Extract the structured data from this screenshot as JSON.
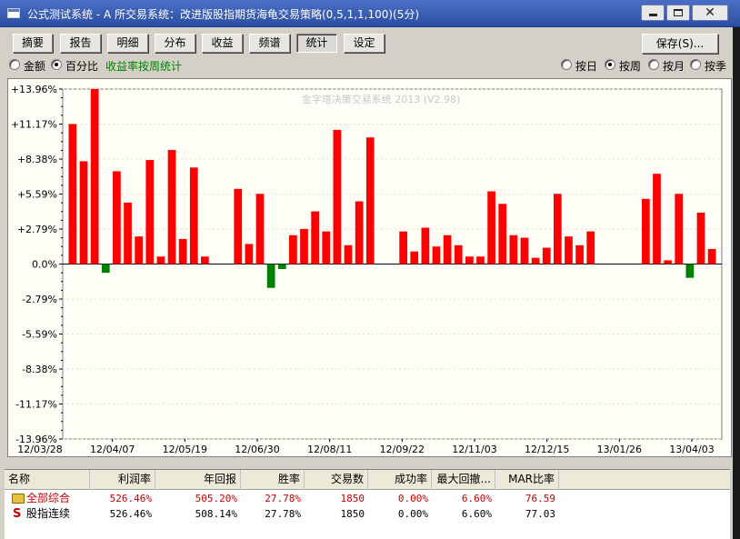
{
  "window": {
    "title": "公式测试系统 - A 所交易系统：改进版股指期货海龟交易策略(0,5,1,1,100)(5分)",
    "buttons": {
      "min": "minimize",
      "max": "maximize",
      "close": "close"
    }
  },
  "tabs": [
    "摘要",
    "报告",
    "明细",
    "分布",
    "收益",
    "频谱",
    "统计",
    "设定"
  ],
  "active_tab": "统计",
  "save_button": "保存(S)...",
  "mode_options": {
    "amount": "金额",
    "percent": "百分比",
    "selected": "百分比",
    "description": "收益率按周统计"
  },
  "period_options": {
    "day": "按日",
    "week": "按周",
    "month": "按月",
    "quarter": "按季",
    "selected": "按周"
  },
  "colors": {
    "positive": "#ff0000",
    "negative": "#008000",
    "background": "#fefdf6",
    "grid": "#d0d0d0"
  },
  "chart_data": {
    "type": "bar",
    "watermark": "金字塔决策交易系统 2013 (V2.98)",
    "ylim": [
      -13.96,
      13.96
    ],
    "ytick_labels": [
      "+13.96%",
      "+11.17%",
      "+8.38%",
      "+5.59%",
      "+2.79%",
      "0.0%",
      "-2.79%",
      "-5.59%",
      "-8.38%",
      "-11.17%",
      "-13.96%"
    ],
    "xtick_labels": [
      "12/03/28",
      "12/04/07",
      "12/05/19",
      "12/06/30",
      "12/08/11",
      "12/09/22",
      "12/11/03",
      "12/12/15",
      "13/01/26",
      "13/04/03"
    ],
    "series": [
      {
        "values": [
          11.17,
          8.2,
          13.96,
          -0.7,
          7.4,
          4.9,
          2.2,
          8.3,
          0.6,
          9.1,
          2.0,
          7.7,
          0.6,
          null,
          null,
          6.0,
          1.6,
          5.6,
          -1.9,
          -0.4,
          2.3,
          2.8,
          4.2,
          2.6,
          10.7,
          1.5,
          5.0,
          10.1,
          null,
          null,
          2.6,
          1.0,
          2.9,
          1.4,
          2.3,
          1.5,
          0.6,
          0.6,
          5.8,
          4.8,
          2.3,
          2.1,
          0.5,
          1.3,
          5.6,
          2.2,
          1.5,
          2.6,
          null,
          null,
          null,
          null,
          5.2,
          7.2,
          0.3,
          5.6,
          -1.1,
          4.1,
          1.2
        ]
      }
    ]
  },
  "table": {
    "headers": [
      "名称",
      "利润率",
      "年回报",
      "胜率",
      "交易数",
      "成功率",
      "最大回撤...",
      "MAR比率"
    ],
    "rows": [
      {
        "icon": "folder-icon",
        "name": "全部综合",
        "profit": "526.46%",
        "annual": "505.20%",
        "win": "27.78%",
        "trades": "1850",
        "success": "0.00%",
        "drawdown": "6.60%",
        "mar": "76.59"
      },
      {
        "icon": "stock-index-icon",
        "name": "股指连续",
        "profit": "526.46%",
        "annual": "508.14%",
        "win": "27.78%",
        "trades": "1850",
        "success": "0.00%",
        "drawdown": "6.60%",
        "mar": "77.03"
      }
    ]
  }
}
